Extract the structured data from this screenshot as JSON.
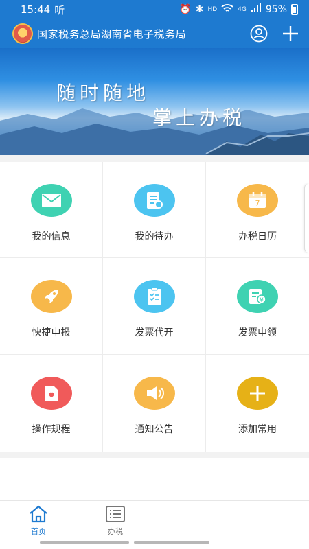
{
  "status_bar": {
    "time": "15:44",
    "tiktok_label": "听",
    "hd": "HD",
    "network": "4G",
    "battery": "95%"
  },
  "app_bar": {
    "title": "国家税务总局湖南省电子税务局"
  },
  "banner": {
    "line1": "随时随地",
    "line2": "掌上办税"
  },
  "menu": [
    {
      "label": "我的信息",
      "icon": "mail-icon",
      "color": "#3fd2b2"
    },
    {
      "label": "我的待办",
      "icon": "todo-icon",
      "color": "#4cc4f0"
    },
    {
      "label": "办税日历",
      "icon": "calendar-icon",
      "color": "#f7b84a"
    },
    {
      "label": "快捷申报",
      "icon": "rocket-icon",
      "color": "#f7b84a"
    },
    {
      "label": "发票代开",
      "icon": "checklist-icon",
      "color": "#4cc4f0"
    },
    {
      "label": "发票申领",
      "icon": "invoice-icon",
      "color": "#3fd2b2"
    },
    {
      "label": "操作规程",
      "icon": "guide-icon",
      "color": "#f05a5a"
    },
    {
      "label": "通知公告",
      "icon": "speaker-icon",
      "color": "#f7b84a"
    },
    {
      "label": "添加常用",
      "icon": "plus-icon",
      "color": "#e6b117"
    }
  ],
  "calendar_day": "7",
  "invoice_currency": "¥",
  "bottom_nav": {
    "home": "首页",
    "tax": "办税"
  },
  "colors": {
    "primary": "#1e7ad0"
  }
}
